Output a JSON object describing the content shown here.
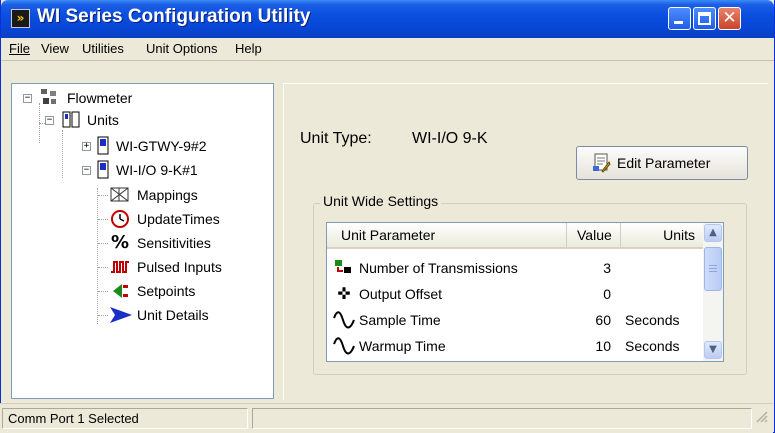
{
  "window": {
    "title": "WI Series Configuration Utility"
  },
  "menu": [
    "File",
    "View",
    "Utilities",
    "Unit Options",
    "Help"
  ],
  "tree": {
    "root": "Flowmeter",
    "units": "Units",
    "gateway": "WI-GTWY-9#2",
    "io_unit": "WI-I/O 9-K#1",
    "children": [
      "Mappings",
      "UpdateTimes",
      "Sensitivities",
      "Pulsed Inputs",
      "Setpoints",
      "Unit Details"
    ]
  },
  "unit_type": {
    "label": "Unit Type:",
    "value": "WI-I/O 9-K"
  },
  "edit_button": {
    "label": "Edit Parameter"
  },
  "group": {
    "label": "Unit Wide Settings"
  },
  "grid": {
    "headers": {
      "param": "Unit Parameter",
      "value": "Value",
      "units": "Units"
    },
    "rows": [
      {
        "param": "Number of Transmissions",
        "value": "3",
        "units": ""
      },
      {
        "param": "Output Offset",
        "value": "0",
        "units": ""
      },
      {
        "param": "Sample Time",
        "value": "60",
        "units": "Seconds"
      },
      {
        "param": "Warmup Time",
        "value": "10",
        "units": "Seconds"
      }
    ]
  },
  "status": {
    "text": "Comm Port 1 Selected"
  },
  "colors": {
    "titlebar": "#0a4fdf",
    "selection_arrow": "#1a2fc8"
  }
}
